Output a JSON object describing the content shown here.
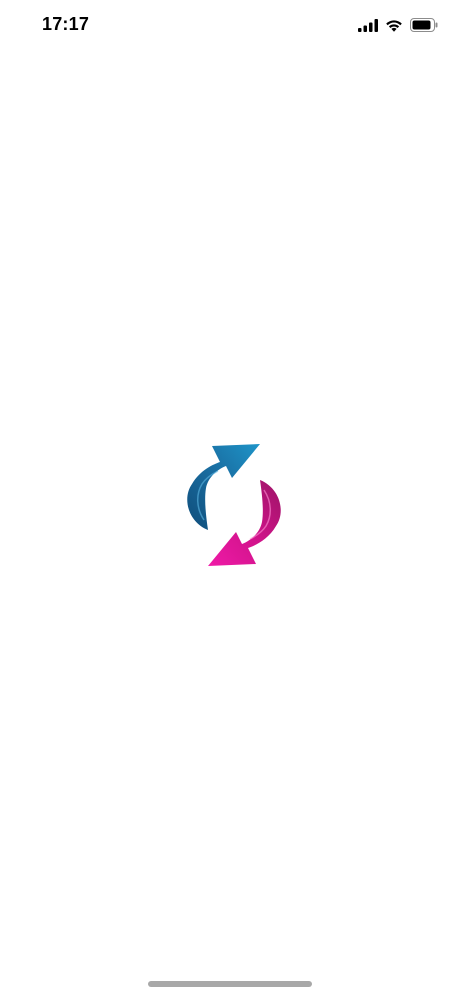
{
  "status_bar": {
    "time": "17:17",
    "icons": [
      "cellular-signal-icon",
      "wifi-icon",
      "battery-icon"
    ]
  },
  "splash": {
    "logo_icon": "sync-arrows-icon",
    "colors": {
      "arrow_top": "#1a6fa3",
      "arrow_bottom": "#e0108f"
    }
  }
}
